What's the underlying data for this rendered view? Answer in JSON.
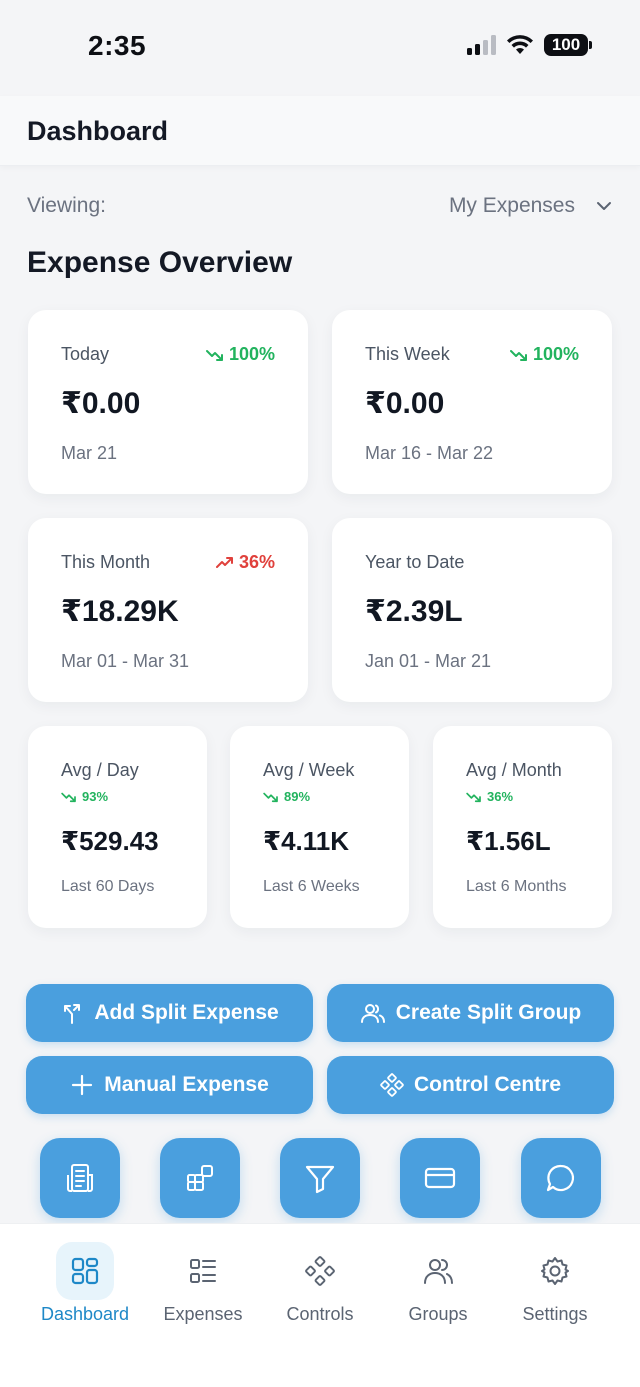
{
  "status_bar": {
    "time": "2:35",
    "battery": "100"
  },
  "header": {
    "title": "Dashboard"
  },
  "viewing": {
    "label": "Viewing:",
    "selected": "My Expenses"
  },
  "section_title": "Expense Overview",
  "cards": [
    {
      "label": "Today",
      "trend": "100%",
      "trend_dir": "down",
      "amount": "₹0.00",
      "range": "Mar 21"
    },
    {
      "label": "This Week",
      "trend": "100%",
      "trend_dir": "down",
      "amount": "₹0.00",
      "range": "Mar 16 - Mar 22"
    },
    {
      "label": "This Month",
      "trend": "36%",
      "trend_dir": "up",
      "amount": "₹18.29K",
      "range": "Mar 01 - Mar 31"
    },
    {
      "label": "Year to Date",
      "trend": "",
      "amount": "₹2.39L",
      "range": "Jan 01 - Mar 21"
    }
  ],
  "avg_cards": [
    {
      "label": "Avg / Day",
      "trend": "93%",
      "amount": "₹529.43",
      "range": "Last 60 Days"
    },
    {
      "label": "Avg / Week",
      "trend": "89%",
      "amount": "₹4.11K",
      "range": "Last 6 Weeks"
    },
    {
      "label": "Avg / Month",
      "trend": "36%",
      "amount": "₹1.56L",
      "range": "Last 6 Months"
    }
  ],
  "actions": {
    "add_split": "Add Split Expense",
    "create_group": "Create Split Group",
    "manual": "Manual Expense",
    "control_centre": "Control Centre"
  },
  "quick_icons": [
    "receipt-icon",
    "widgets-icon",
    "filter-icon",
    "card-icon",
    "chat-icon"
  ],
  "bottom_nav": [
    {
      "label": "Dashboard",
      "icon": "dashboard-icon",
      "active": true
    },
    {
      "label": "Expenses",
      "icon": "list-icon",
      "active": false
    },
    {
      "label": "Controls",
      "icon": "controls-icon",
      "active": false
    },
    {
      "label": "Groups",
      "icon": "groups-icon",
      "active": false
    },
    {
      "label": "Settings",
      "icon": "gear-icon",
      "active": false
    }
  ],
  "colors": {
    "accent": "#4a9fde",
    "positive": "#22b35e",
    "negative": "#e0413c",
    "nav_active": "#1e88c7"
  }
}
